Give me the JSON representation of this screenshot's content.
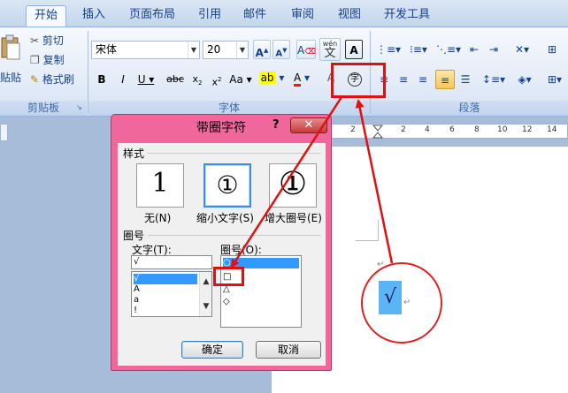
{
  "tabs": [
    {
      "label": "开始",
      "active": true
    },
    {
      "label": "插入"
    },
    {
      "label": "页面布局"
    },
    {
      "label": "引用"
    },
    {
      "label": "邮件"
    },
    {
      "label": "审阅"
    },
    {
      "label": "视图"
    },
    {
      "label": "开发工具"
    }
  ],
  "clipboard": {
    "paste": "贴贴",
    "cut": "剪切",
    "copy": "复制",
    "format_painter": "格式刷",
    "group_label": "剪贴板"
  },
  "font": {
    "font_name": "宋体",
    "font_size": "20",
    "group_label": "字体",
    "wen_label": "wén",
    "wen_char": "文",
    "enclose_char": "字"
  },
  "paragraph": {
    "group_label": "段落"
  },
  "ruler": {
    "ticks": [
      "2",
      "2",
      "4",
      "6",
      "8",
      "10",
      "12",
      "14"
    ]
  },
  "document": {
    "pilcrow": "↵",
    "check": "√"
  },
  "dialog": {
    "title": "带圈字符",
    "help": "?",
    "close": "✕",
    "style_section": "样式",
    "styles": [
      {
        "label": "无(N)",
        "char": "1"
      },
      {
        "label": "缩小文字(S)",
        "char": "①"
      },
      {
        "label": "增大圈号(E)",
        "char": "①"
      }
    ],
    "enclosure_section": "圈号",
    "text_label": "文字(T):",
    "enclosure_label": "圈号(O):",
    "text_value": "√",
    "text_items": [
      "√",
      "A",
      "a",
      "!"
    ],
    "enclosure_items": [
      "○",
      "□",
      "△",
      "◇"
    ],
    "ok": "确定",
    "cancel": "取消"
  },
  "colors": {
    "annotation": "#e01010",
    "dialog_frame": "#f0689b",
    "ribbon_text": "#15428b"
  }
}
